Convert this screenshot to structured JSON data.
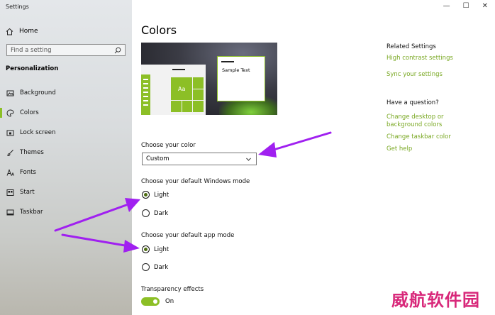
{
  "window": {
    "title": "Settings",
    "minimize": "—",
    "maximize": "☐",
    "close": "✕"
  },
  "sidebar": {
    "home_label": "Home",
    "search_placeholder": "Find a setting",
    "section": "Personalization",
    "items": [
      {
        "label": "Background",
        "icon": "image-icon"
      },
      {
        "label": "Colors",
        "icon": "palette-icon",
        "active": true
      },
      {
        "label": "Lock screen",
        "icon": "lock-screen-icon"
      },
      {
        "label": "Themes",
        "icon": "brush-icon"
      },
      {
        "label": "Fonts",
        "icon": "font-icon"
      },
      {
        "label": "Start",
        "icon": "start-icon"
      },
      {
        "label": "Taskbar",
        "icon": "taskbar-icon"
      }
    ]
  },
  "main": {
    "title": "Colors",
    "preview": {
      "tile_text": "Aa",
      "sample_text": "Sample Text"
    },
    "choose_color": {
      "label": "Choose your color",
      "value": "Custom"
    },
    "windows_mode": {
      "label": "Choose your default Windows mode",
      "options": [
        "Light",
        "Dark"
      ],
      "selected": "Light"
    },
    "app_mode": {
      "label": "Choose your default app mode",
      "options": [
        "Light",
        "Dark"
      ],
      "selected": "Light"
    },
    "transparency": {
      "label": "Transparency effects",
      "state": "On"
    }
  },
  "related": {
    "heading": "Related Settings",
    "links": [
      "High contrast settings",
      "Sync your settings"
    ],
    "question_heading": "Have a question?",
    "help_links": [
      "Change desktop or background colors",
      "Change taskbar color",
      "Get help"
    ]
  },
  "watermark": "威航软件园",
  "colors": {
    "accent": "#8cbf26",
    "link": "#79a822",
    "arrow": "#a020f0",
    "watermark": "#d8287a"
  }
}
